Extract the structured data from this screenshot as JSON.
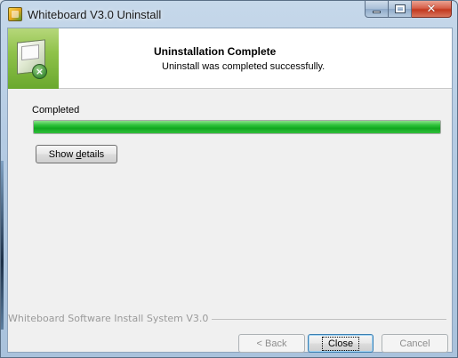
{
  "window": {
    "title": "Whiteboard V3.0 Uninstall",
    "controls": {
      "minimize": "minimize",
      "maximize": "maximize",
      "close_glyph": "✕"
    }
  },
  "header": {
    "title": "Uninstallation Complete",
    "subtitle": "Uninstall was completed successfully."
  },
  "main": {
    "status_label": "Completed",
    "progress_percent": 100,
    "show_details_label": "Show details",
    "show_details_accel": "d"
  },
  "footer": {
    "branding": "Whiteboard Software Install System V3.0",
    "back_label": "< Back",
    "close_label": "Close",
    "cancel_label": "Cancel"
  },
  "colors": {
    "progress_green": "#11a71f",
    "header_graphic_green": "#8fc24a",
    "close_button_red": "#c2391f"
  },
  "icons": [
    "app-icon",
    "uninstall-box-icon",
    "x-badge-icon",
    "minimize-icon",
    "maximize-icon",
    "close-icon"
  ]
}
